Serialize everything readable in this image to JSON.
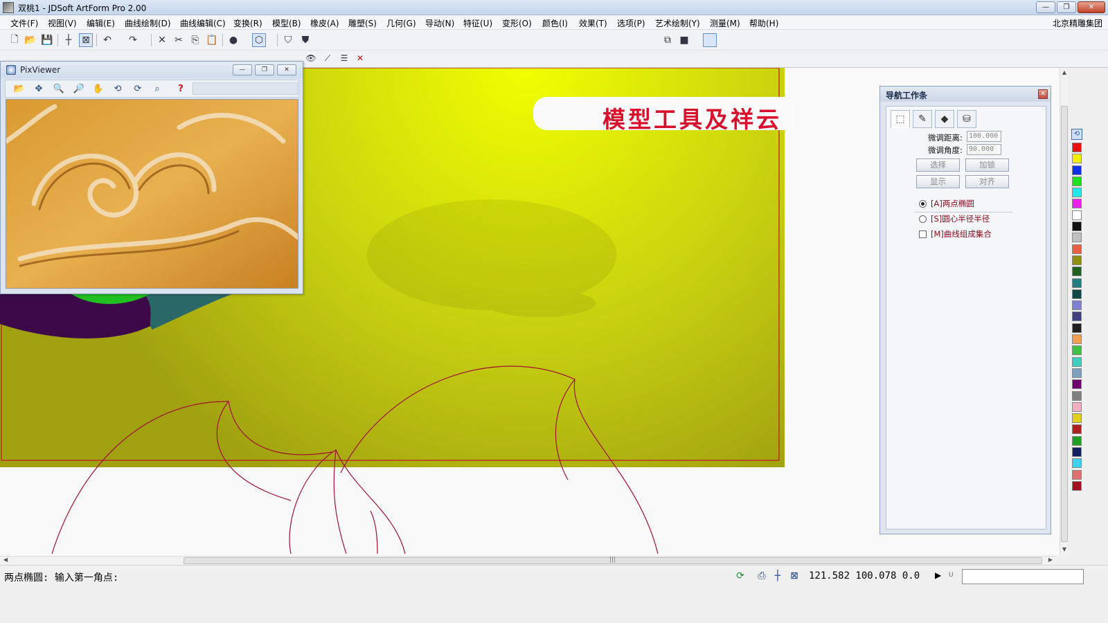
{
  "window": {
    "title": "双桃1 - JDSoft ArtForm Pro 2.00",
    "minimize": "—",
    "restore": "❐",
    "close": "✕"
  },
  "menu": {
    "items": [
      "文件(F)",
      "视图(V)",
      "编辑(E)",
      "曲线绘制(D)",
      "曲线编辑(C)",
      "变换(R)",
      "模型(B)",
      "橡皮(A)",
      "雕塑(S)",
      "几何(G)",
      "导动(N)",
      "特征(U)",
      "变形(O)",
      "颜色(I)",
      "效果(T)",
      "选项(P)",
      "艺术绘制(Y)",
      "测量(M)",
      "帮助(H)"
    ],
    "company": "北京精雕集团"
  },
  "canvas": {
    "banner_text": "模型工具及祥云",
    "colors": {
      "yellow_top": "#e8ff00",
      "olive_bottom": "#a0a010",
      "outline_red": "#c0102a",
      "purple": "#3c0848",
      "teal": "#2a6868",
      "green": "#20c020"
    }
  },
  "pixviewer": {
    "title": "PixViewer",
    "minimize": "—",
    "restore": "❐",
    "close": "✕",
    "help": "?"
  },
  "nav_panel": {
    "title": "导航工作条",
    "close": "✕",
    "fine_distance_label": "微调距离:",
    "fine_distance_value": "100.000",
    "fine_angle_label": "微调角度:",
    "fine_angle_value": "90.000",
    "buttons": {
      "select": "选择",
      "lock": "加锁",
      "display": "显示",
      "align": "对齐"
    },
    "options": {
      "two_point_ellipse": "[A]两点椭圆",
      "center_radius": "[S]圆心半径半径",
      "curve_set": "[M]曲线组成集合"
    }
  },
  "palette": {
    "colors": [
      "#e81010",
      "#f0f000",
      "#1030e8",
      "#20e020",
      "#20e8e8",
      "#e820e8",
      "#ffffff",
      "#101010",
      "#c0c0c0",
      "#e86040",
      "#909010",
      "#206020",
      "#208080",
      "#104848",
      "#8080d0",
      "#404080",
      "#202020",
      "#f0a050",
      "#40c040",
      "#40d0c0",
      "#80a0c0",
      "#700070",
      "#808080",
      "#f0b0c0",
      "#e0d020",
      "#b02020",
      "#20a020",
      "#102060",
      "#40d0f0",
      "#e07070",
      "#a01020"
    ]
  },
  "status": {
    "prompt": "两点椭圆: 输入第一角点:",
    "coords": "121.582 100.078 0.0",
    "arrow": "▶",
    "unit": "U"
  }
}
